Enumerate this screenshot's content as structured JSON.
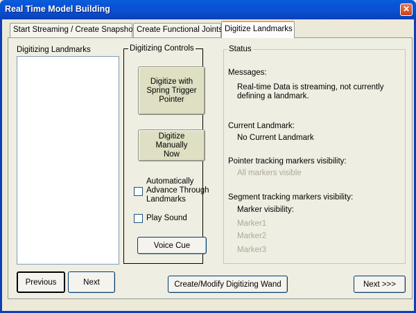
{
  "window": {
    "title": "Real Time Model Building",
    "close_glyph": "✕"
  },
  "tabs": [
    {
      "label": "Start Streaming / Create Snapshot",
      "active": false
    },
    {
      "label": "Create Functional Joints",
      "active": false
    },
    {
      "label": "Digitize Landmarks",
      "active": true
    }
  ],
  "landmarks": {
    "label": "Digitizing Landmarks"
  },
  "controls": {
    "title": "Digitizing Controls",
    "digitize_spring_label": "Digitize with\nSpring Trigger\nPointer",
    "digitize_manual_label": "Digitize\nManually\nNow",
    "auto_advance_label": "Automatically\nAdvance Through\nLandmarks",
    "play_sound_label": "Play Sound",
    "voice_cue_label": "Voice Cue"
  },
  "status": {
    "title": "Status",
    "messages_label": "Messages:",
    "messages_text": "Real-time Data is streaming, not currently\ndefining a landmark.",
    "current_landmark_label": "Current Landmark:",
    "current_landmark_value": "No Current Landmark",
    "pointer_visibility_label": "Pointer tracking markers visibility:",
    "pointer_visibility_value": "All markers visible",
    "segment_visibility_label": "Segment tracking markers visibility:",
    "marker_visibility_label": "Marker visibility:",
    "markers": [
      "Marker1",
      "Marker2",
      "Marker3"
    ]
  },
  "footer": {
    "previous_label": "Previous",
    "next_label": "Next",
    "wand_label": "Create/Modify Digitizing Wand",
    "next_step_label": "Next >>>"
  }
}
